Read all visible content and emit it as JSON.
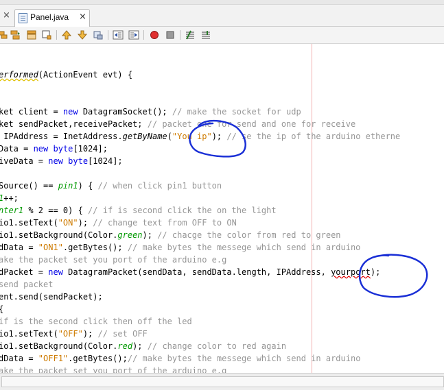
{
  "tabs": [
    {
      "label": "Panel.java",
      "close": "×"
    }
  ],
  "left_tab_close": "×",
  "toolbar_icons": [
    "back-icon",
    "forward-icon",
    "open-class-icon",
    "find-selection-icon",
    "find-previous-icon",
    "find-next-icon",
    "toggle-bookmark-icon",
    "shift-left-icon",
    "shift-right-icon",
    "start-macro-icon",
    "stop-macro-icon",
    "comment-icon",
    "uncomment-icon"
  ],
  "code_lines": [
    [],
    [],
    [
      [
        "erformed",
        null
      ],
      [
        "(ActionEvent evt) {",
        null
      ]
    ],
    [],
    [],
    [
      [
        "ket client = ",
        null
      ],
      [
        "new",
        null
      ],
      [
        " DatagramSocket(); ",
        null
      ],
      [
        "// make the socket for udp",
        null
      ]
    ],
    [
      [
        "ket sendPacket,receivePacket; ",
        null
      ],
      [
        "// packet one for send and one for receive",
        null
      ]
    ],
    [
      [
        " IPAddress = InetAddress.",
        null
      ],
      [
        "getByName",
        null
      ],
      [
        "(",
        null
      ],
      [
        "\"You ip\"",
        null
      ],
      [
        "); ",
        null
      ],
      [
        "// se the ip of the arduino etherne",
        null
      ]
    ],
    [
      [
        "Data = ",
        null
      ],
      [
        "new",
        null
      ],
      [
        " ",
        null
      ],
      [
        "byte",
        null
      ],
      [
        "[1024];",
        null
      ]
    ],
    [
      [
        "iveData = ",
        null
      ],
      [
        "new",
        null
      ],
      [
        " ",
        null
      ],
      [
        "byte",
        null
      ],
      [
        "[1024];",
        null
      ]
    ],
    [],
    [
      [
        "Source() == ",
        null
      ],
      [
        "pin1",
        null
      ],
      [
        ") { ",
        null
      ],
      [
        "// when click pin1 button",
        null
      ]
    ],
    [
      [
        "1",
        null
      ],
      [
        "++;",
        null
      ]
    ],
    [
      [
        "nter1",
        null
      ],
      [
        " % 2 == 0) { ",
        null
      ],
      [
        "// if is second click the on the light",
        null
      ]
    ],
    [
      [
        "io1.setText(",
        null
      ],
      [
        "\"ON\"",
        null
      ],
      [
        "); ",
        null
      ],
      [
        "// change text from OFF to ON",
        null
      ]
    ],
    [
      [
        "io1.setBackground(Color.",
        null
      ],
      [
        "green",
        null
      ],
      [
        "); ",
        null
      ],
      [
        "// chacge the color from red to green",
        null
      ]
    ],
    [
      [
        "dData = ",
        null
      ],
      [
        "\"ON1\"",
        null
      ],
      [
        ".getBytes(); ",
        null
      ],
      [
        "// make bytes the messege which send in arduino",
        null
      ]
    ],
    [
      [
        "ake the packet set you port of the arduino e.g",
        null
      ]
    ],
    [
      [
        "dPacket = ",
        null
      ],
      [
        "new",
        null
      ],
      [
        " DatagramPacket(sendData, sendData.length, IPAddress, ",
        null
      ],
      [
        "yourport",
        null
      ],
      [
        ");",
        null
      ]
    ],
    [
      [
        "send packet",
        null
      ]
    ],
    [
      [
        "ent.send(sendPacket);",
        null
      ]
    ],
    [
      [
        "{",
        null
      ]
    ],
    [
      [
        "if is the second click then off the led",
        null
      ]
    ],
    [
      [
        "io1.setText(",
        null
      ],
      [
        "\"OFF\"",
        null
      ],
      [
        "); ",
        null
      ],
      [
        "// set OFF",
        null
      ]
    ],
    [
      [
        "io1.setBackground(Color.",
        null
      ],
      [
        "red",
        null
      ],
      [
        "); ",
        null
      ],
      [
        "// change color to red again",
        null
      ]
    ],
    [
      [
        "dData = ",
        null
      ],
      [
        "\"OFF1\"",
        null
      ],
      [
        ".getBytes();",
        null
      ],
      [
        "// make bytes the messege which send in arduino",
        null
      ]
    ],
    [
      [
        "ake the packet set you port of the arduino e.g",
        null
      ]
    ]
  ],
  "colors": {
    "keyword": "#0000e6",
    "comment": "#969696",
    "string": "#ce7b00",
    "field": "#009900",
    "margin_line": "#f2b0b0",
    "annotation_ink": "#1a2fd6"
  }
}
